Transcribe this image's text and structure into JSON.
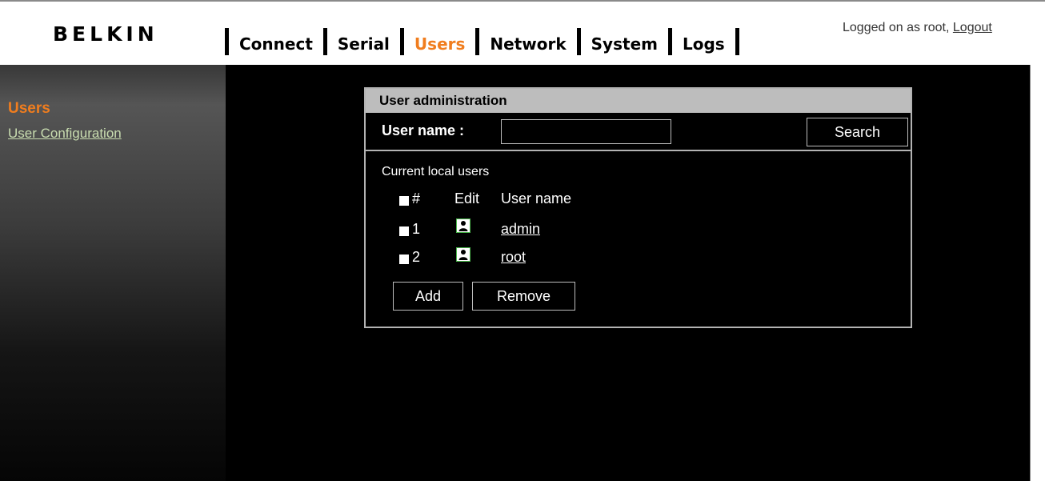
{
  "brand": {
    "logo_text": "BELKIN"
  },
  "nav": {
    "items": [
      {
        "label": "Connect"
      },
      {
        "label": "Serial"
      },
      {
        "label": "Users"
      },
      {
        "label": "Network"
      },
      {
        "label": "System"
      },
      {
        "label": "Logs"
      }
    ],
    "active": "Users",
    "active_color": "#f07d1e"
  },
  "session": {
    "logged_on_text": "Logged on as root,",
    "logout_label": "Logout"
  },
  "sidebar": {
    "title": "Users",
    "items": [
      {
        "label": "User Configuration"
      }
    ]
  },
  "panel": {
    "title": "User administration",
    "search": {
      "label": "User name :",
      "value": "",
      "button_label": "Search"
    },
    "users_heading": "Current local users",
    "columns": {
      "number": "#",
      "edit": "Edit",
      "username": "User name"
    },
    "rows": [
      {
        "number": "1",
        "username": "admin",
        "edit_icon": "user-icon"
      },
      {
        "number": "2",
        "username": "root",
        "edit_icon": "user-icon"
      }
    ],
    "add_label": "Add",
    "remove_label": "Remove"
  }
}
